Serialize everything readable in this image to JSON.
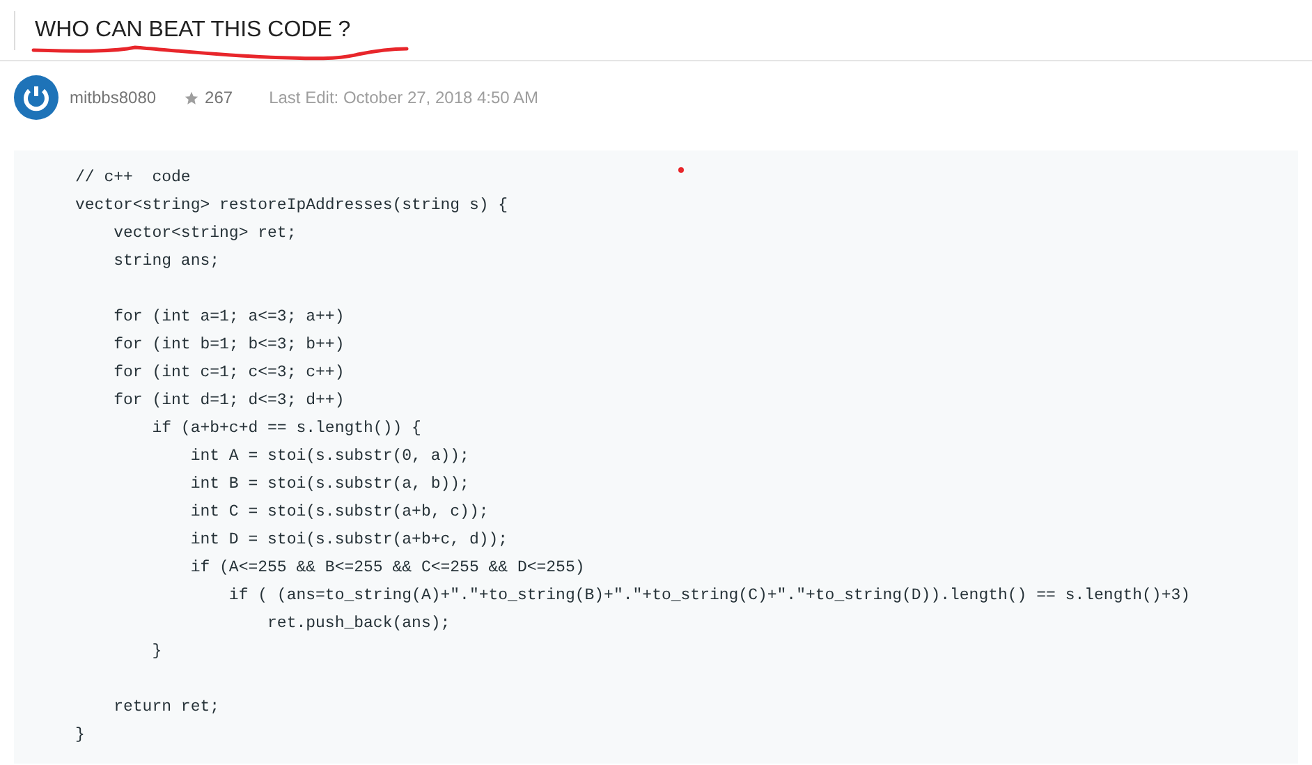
{
  "title": "WHO CAN BEAT THIS CODE ?",
  "author": {
    "name": "mitbbs8080",
    "reputation": "267",
    "last_edit": "Last Edit: October 27, 2018 4:50 AM"
  },
  "code_lines": [
    {
      "kind": "code",
      "text": "// c++  code"
    },
    {
      "kind": "code",
      "text": "vector<string> restoreIpAddresses(string s) {"
    },
    {
      "kind": "code",
      "text": "    vector<string> ret;"
    },
    {
      "kind": "code",
      "text": "    string ans;"
    },
    {
      "kind": "blank"
    },
    {
      "kind": "code",
      "text": "    for (int a=1; a<=3; a++)"
    },
    {
      "kind": "code",
      "text": "    for (int b=1; b<=3; b++)"
    },
    {
      "kind": "code",
      "text": "    for (int c=1; c<=3; c++)"
    },
    {
      "kind": "code",
      "text": "    for (int d=1; d<=3; d++)"
    },
    {
      "kind": "code",
      "text": "        if (a+b+c+d == s.length()) {"
    },
    {
      "kind": "code",
      "text": "            int A = stoi(s.substr(0, a));"
    },
    {
      "kind": "code",
      "text": "            int B = stoi(s.substr(a, b));"
    },
    {
      "kind": "code",
      "text": "            int C = stoi(s.substr(a+b, c));"
    },
    {
      "kind": "code",
      "text": "            int D = stoi(s.substr(a+b+c, d));"
    },
    {
      "kind": "code",
      "text": "            if (A<=255 && B<=255 && C<=255 && D<=255)"
    },
    {
      "kind": "code",
      "text": "                if ( (ans=to_string(A)+\".\"+to_string(B)+\".\"+to_string(C)+\".\"+to_string(D)).length() == s.length()+3)"
    },
    {
      "kind": "code",
      "text": "                    ret.push_back(ans);"
    },
    {
      "kind": "code",
      "text": "        }"
    },
    {
      "kind": "blank"
    },
    {
      "kind": "code",
      "text": "    return ret;"
    },
    {
      "kind": "code",
      "text": "}"
    }
  ]
}
